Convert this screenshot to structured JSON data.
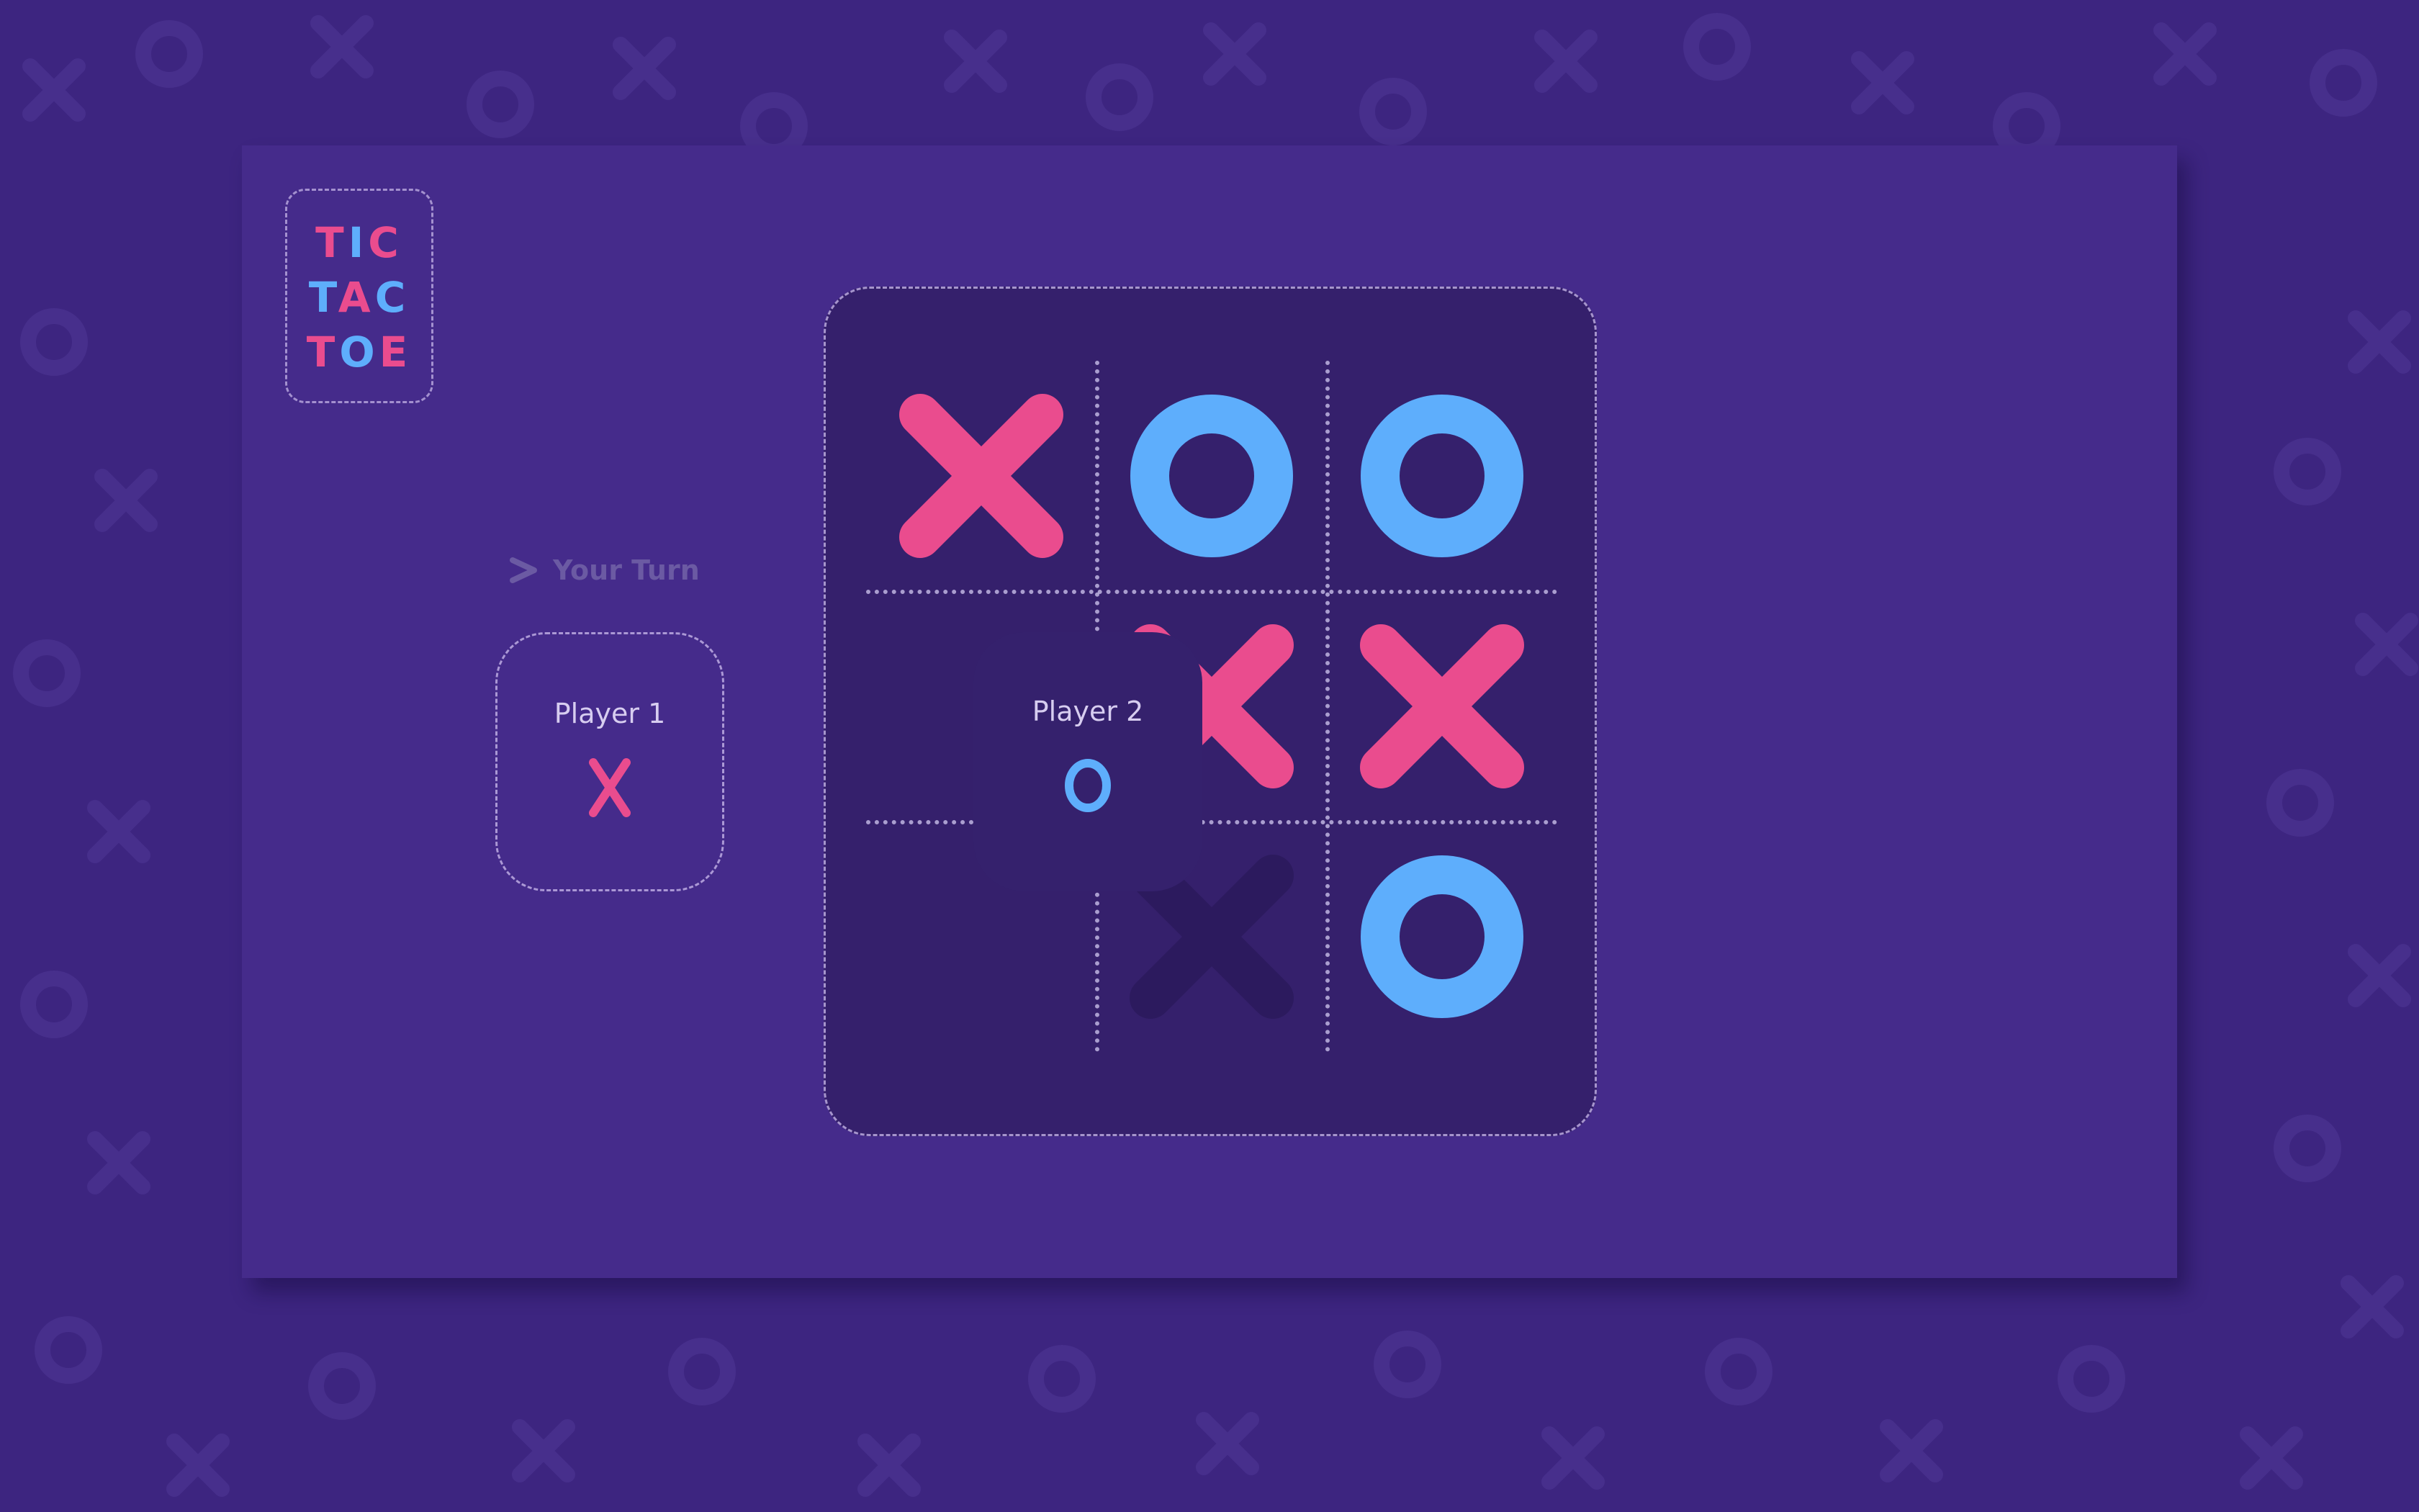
{
  "game": {
    "title_lines": [
      [
        {
          "ch": "T",
          "color": "pink"
        },
        {
          "ch": "I",
          "color": "blue"
        },
        {
          "ch": "C",
          "color": "pink"
        }
      ],
      [
        {
          "ch": "T",
          "color": "blue"
        },
        {
          "ch": "A",
          "color": "pink"
        },
        {
          "ch": "C",
          "color": "blue"
        }
      ],
      [
        {
          "ch": "T",
          "color": "pink"
        },
        {
          "ch": "O",
          "color": "blue"
        },
        {
          "ch": "E",
          "color": "pink"
        }
      ]
    ],
    "turn_label": "Your Turn",
    "current_turn": "player1"
  },
  "players": {
    "player1": {
      "name": "Player 1",
      "symbol": "X"
    },
    "player2": {
      "name": "Player 2",
      "symbol": "O"
    }
  },
  "board": {
    "cells": [
      [
        "X",
        "O",
        "O"
      ],
      [
        "",
        "X",
        "X"
      ],
      [
        "",
        "X-preview",
        "O"
      ]
    ]
  },
  "colors": {
    "background": "#3d2580",
    "panel": "#452b8b",
    "board": "#35206c",
    "x_color": "#ea4c8e",
    "o_color": "#5eaefc",
    "preview_x": "#2c1a5e",
    "muted_text": "#6b5aa3"
  },
  "icons": {
    "turn_indicator": "chevron-right-icon",
    "x_mark": "x-mark-icon",
    "o_mark": "o-mark-icon"
  }
}
